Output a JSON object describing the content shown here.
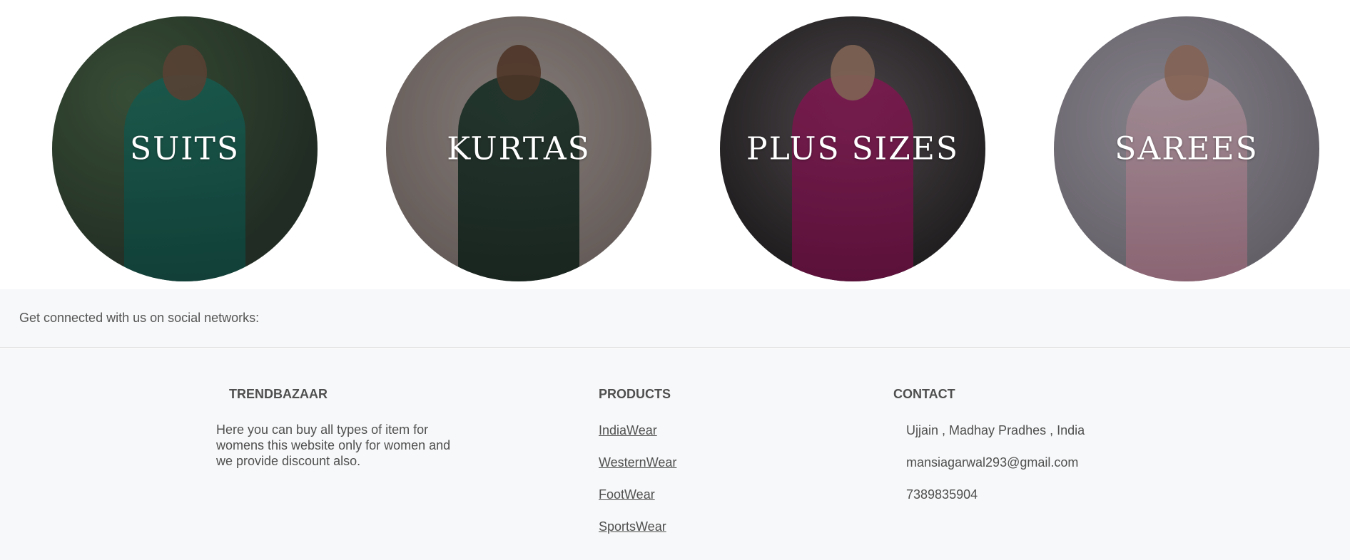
{
  "categories": [
    {
      "label": "SUITS"
    },
    {
      "label": "KURTAS"
    },
    {
      "label": "PLUS SIZES"
    },
    {
      "label": "SAREES"
    }
  ],
  "social": {
    "text": "Get connected with us on social networks:"
  },
  "footer": {
    "brand": {
      "title": "TRENDBAZAAR",
      "description": "Here you can buy all types of item for womens this website only for women and we provide discount also."
    },
    "products": {
      "title": "PRODUCTS",
      "links": [
        "IndiaWear",
        "WesternWear",
        "FootWear",
        "SportsWear"
      ]
    },
    "contact": {
      "title": "CONTACT",
      "address": "Ujjain , Madhay Pradhes , India",
      "email": "mansiagarwal293@gmail.com",
      "phone": "7389835904"
    }
  },
  "colors": {
    "footer_bg": "#f7f8f9",
    "text": "#4f4f4f",
    "suits_accent": "#1f7d6e",
    "kurtas_accent": "#1a3b2e",
    "plus_sizes_accent": "#b0206f",
    "sarees_accent": "#e3c4cf"
  }
}
